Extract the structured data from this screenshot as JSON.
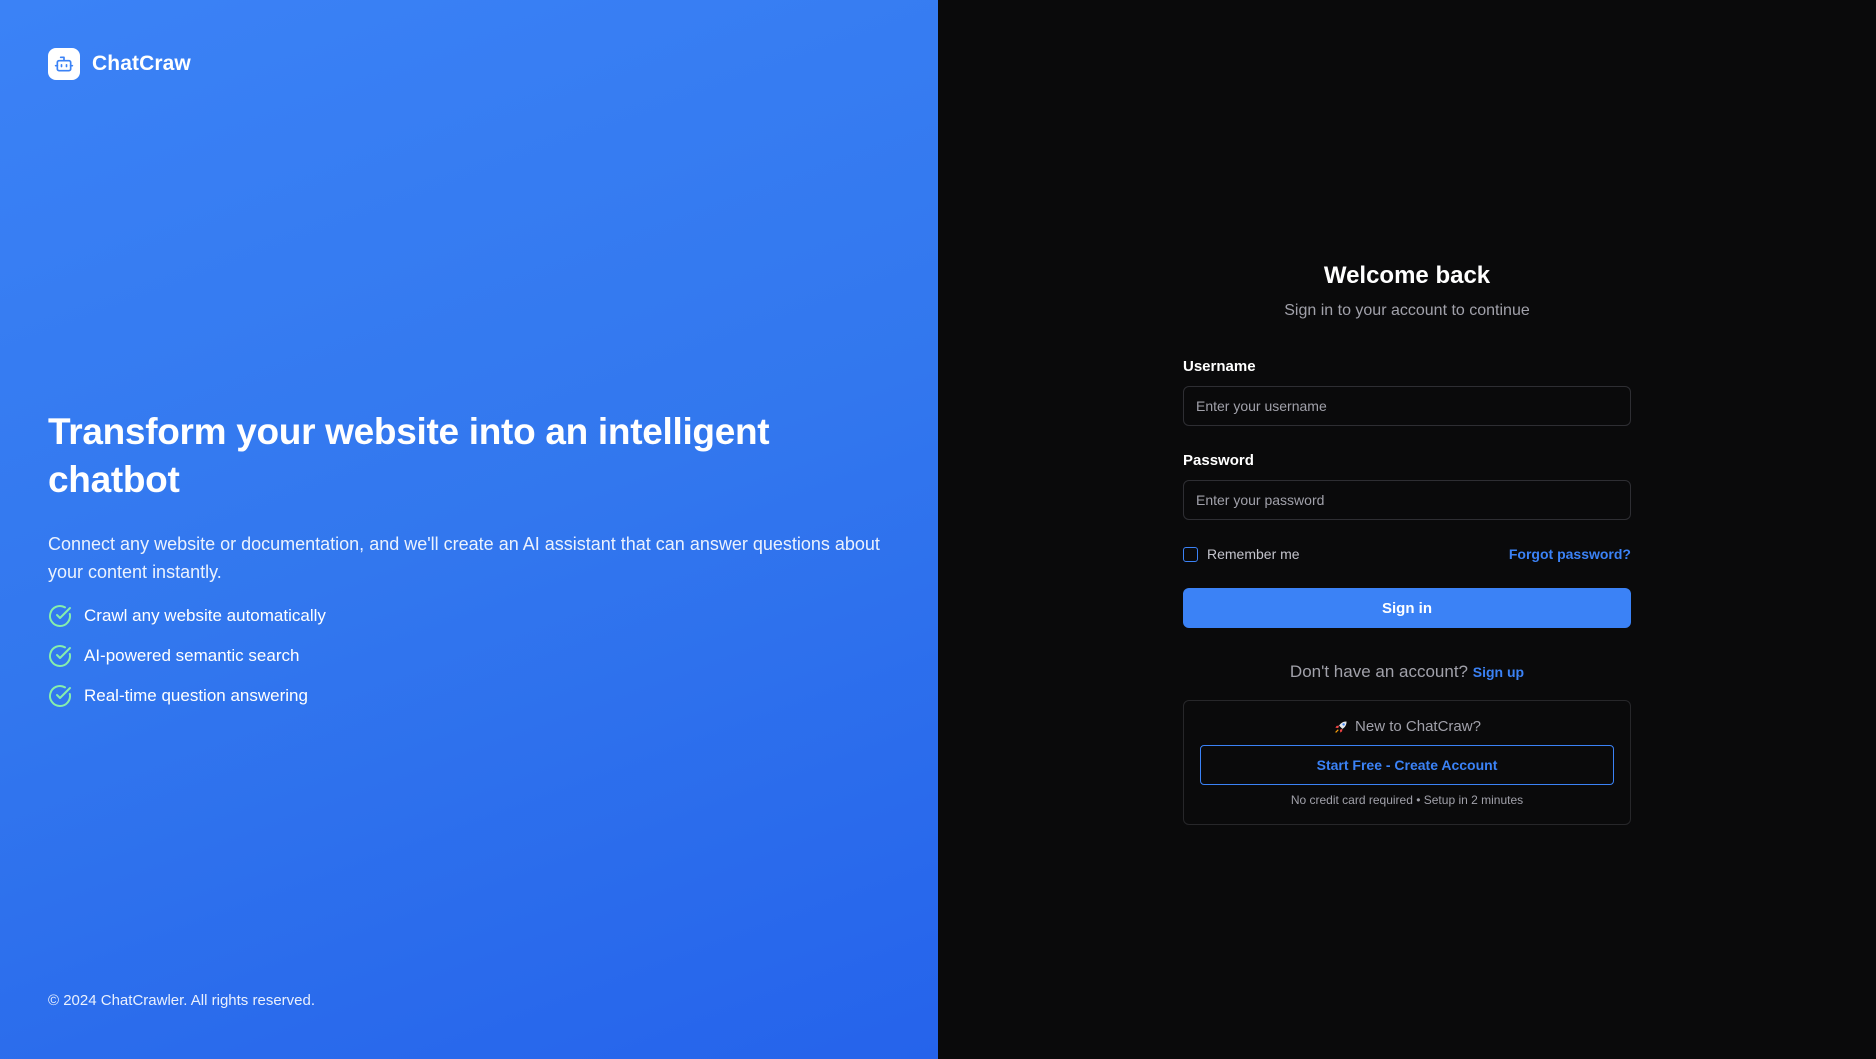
{
  "brand": {
    "name": "ChatCraw",
    "logo_icon": "bot-icon"
  },
  "hero": {
    "title": "Transform your website into an intelligent chatbot",
    "description": "Connect any website or documentation, and we'll create an AI assistant that can answer questions about your content instantly.",
    "features": [
      {
        "label": "Crawl any website automatically",
        "icon": "check-circle-icon"
      },
      {
        "label": "AI-powered semantic search",
        "icon": "check-circle-icon"
      },
      {
        "label": "Real-time question answering",
        "icon": "check-circle-icon"
      }
    ]
  },
  "footer": {
    "copyright": "© 2024 ChatCrawler. All rights reserved."
  },
  "login": {
    "title": "Welcome back",
    "subtitle": "Sign in to your account to continue",
    "username": {
      "label": "Username",
      "placeholder": "Enter your username",
      "value": ""
    },
    "password": {
      "label": "Password",
      "placeholder": "Enter your password",
      "value": ""
    },
    "remember_label": "Remember me",
    "remember_checked": false,
    "forgot_label": "Forgot password?",
    "submit_label": "Sign in",
    "no_account_text": "Don't have an account?",
    "signup_label": "Sign up"
  },
  "promo": {
    "icon": "rocket-icon",
    "heading": "New to ChatCraw?",
    "button_label": "Start Free - Create Account",
    "note": "No credit card required • Setup in 2 minutes"
  },
  "colors": {
    "accent": "#3b82f6",
    "left_bg_start": "#3b82f6",
    "left_bg_end": "#2563eb",
    "right_bg": "#0a0a0b",
    "check_color": "#86efac"
  }
}
